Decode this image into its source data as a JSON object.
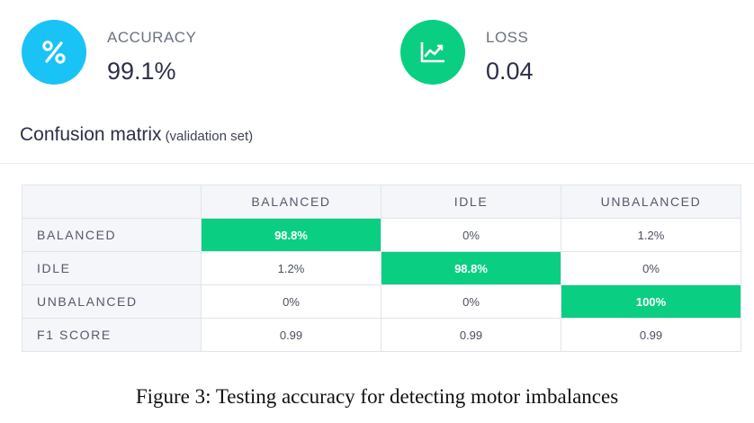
{
  "metrics": {
    "accuracy": {
      "label": "ACCURACY",
      "value": "99.1%",
      "icon": "percent-icon",
      "color": "#19c3f5"
    },
    "loss": {
      "label": "LOSS",
      "value": "0.04",
      "icon": "line-chart-icon",
      "color": "#0acf83"
    }
  },
  "confusion": {
    "title": "Confusion matrix",
    "subtitle": "(validation set)",
    "columns": [
      "BALANCED",
      "IDLE",
      "UNBALANCED"
    ],
    "rows": [
      {
        "label": "BALANCED",
        "cells": [
          "98.8%",
          "0%",
          "1.2%"
        ]
      },
      {
        "label": "IDLE",
        "cells": [
          "1.2%",
          "98.8%",
          "0%"
        ]
      },
      {
        "label": "UNBALANCED",
        "cells": [
          "0%",
          "0%",
          "100%"
        ]
      },
      {
        "label": "F1 SCORE",
        "cells": [
          "0.99",
          "0.99",
          "0.99"
        ]
      }
    ],
    "highlight_color": "#0acf83"
  },
  "caption": "Figure 3: Testing accuracy for detecting motor imbalances"
}
